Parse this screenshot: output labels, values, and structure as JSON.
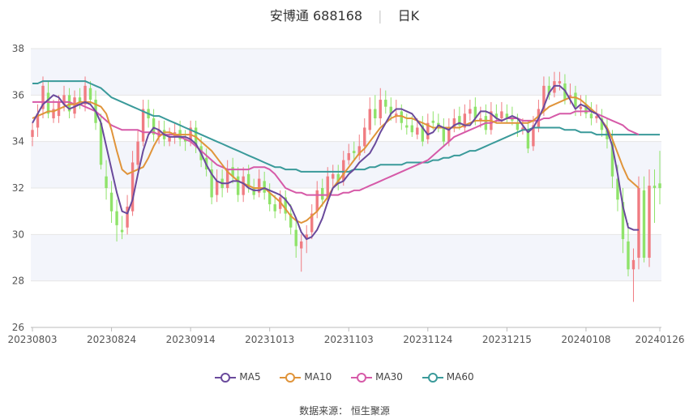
{
  "header": {
    "name": "安博通",
    "code": "688168",
    "period": "日K"
  },
  "source": {
    "label": "数据来源：",
    "name": "恒生聚源"
  },
  "colors": {
    "up": "#f07c82",
    "down": "#8fe36a",
    "ma5": "#6a4a9c",
    "ma10": "#e0943a",
    "ma30": "#d65aa8",
    "ma60": "#3a9a9a",
    "band": "#f3f5fb",
    "grid": "#e6e6e6"
  },
  "chart_data": {
    "type": "candlestick",
    "title": "",
    "y_ticks": [
      26,
      28,
      30,
      32,
      34,
      36,
      38
    ],
    "ylim": [
      26,
      38
    ],
    "x_ticks": [
      "20230803",
      "20230824",
      "20230914",
      "20231013",
      "20231103",
      "20231124",
      "20231215",
      "20240108",
      "20240126"
    ],
    "x_tick_index": [
      0,
      15,
      30,
      45,
      60,
      75,
      90,
      105,
      119
    ],
    "num_bars": 120,
    "legend": [
      "MA5",
      "MA10",
      "MA30",
      "MA60"
    ],
    "ma5": [
      34.8,
      35.2,
      35.6,
      35.8,
      36.0,
      35.9,
      35.6,
      35.4,
      35.5,
      35.6,
      35.7,
      35.6,
      35.3,
      34.8,
      33.8,
      32.8,
      31.8,
      31.0,
      30.9,
      31.5,
      32.6,
      33.6,
      34.3,
      34.6,
      34.5,
      34.3,
      34.2,
      34.2,
      34.2,
      34.2,
      34.1,
      33.9,
      33.5,
      33.0,
      32.6,
      32.3,
      32.2,
      32.2,
      32.3,
      32.3,
      32.2,
      32.0,
      31.9,
      31.9,
      32.0,
      31.9,
      31.8,
      31.7,
      31.5,
      31.2,
      30.7,
      30.1,
      29.8,
      29.9,
      30.2,
      30.7,
      31.4,
      32.0,
      32.2,
      32.3,
      32.6,
      32.8,
      33.1,
      33.3,
      33.5,
      33.9,
      34.4,
      34.8,
      35.2,
      35.4,
      35.4,
      35.3,
      35.2,
      34.9,
      34.6,
      34.3,
      34.4,
      34.7,
      34.6,
      34.5,
      34.7,
      34.8,
      34.7,
      34.7,
      35.0,
      35.3,
      35.3,
      35.2,
      35.0,
      34.9,
      35.0,
      35.1,
      35.0,
      34.7,
      34.4,
      34.6,
      35.0,
      35.5,
      36.1,
      36.4,
      36.4,
      36.2,
      35.8,
      35.4,
      35.6,
      35.5,
      35.3,
      35.2,
      34.9,
      34.5,
      33.8,
      32.6,
      31.2,
      30.3,
      30.2,
      30.2
    ],
    "ma10": [
      35.0,
      35.1,
      35.2,
      35.3,
      35.3,
      35.4,
      35.5,
      35.6,
      35.6,
      35.7,
      35.7,
      35.7,
      35.6,
      35.5,
      35.2,
      34.5,
      33.6,
      32.8,
      32.6,
      32.7,
      32.8,
      32.9,
      33.3,
      33.8,
      34.2,
      34.4,
      34.4,
      34.3,
      34.3,
      34.3,
      34.3,
      34.2,
      34.0,
      33.8,
      33.6,
      33.3,
      33.0,
      32.7,
      32.5,
      32.3,
      32.2,
      32.1,
      32.0,
      32.0,
      32.0,
      31.8,
      31.6,
      31.4,
      31.1,
      30.8,
      30.6,
      30.5,
      30.6,
      30.8,
      31.0,
      31.3,
      31.6,
      32.0,
      32.3,
      32.6,
      32.9,
      33.2,
      33.5,
      33.7,
      34.0,
      34.3,
      34.6,
      34.8,
      35.0,
      35.1,
      35.1,
      35.0,
      35.0,
      34.9,
      34.8,
      34.7,
      34.6,
      34.6,
      34.6,
      34.6,
      34.6,
      34.6,
      34.7,
      34.8,
      34.9,
      34.9,
      34.9,
      34.9,
      34.8,
      34.8,
      34.8,
      34.8,
      34.8,
      34.8,
      34.8,
      34.9,
      35.1,
      35.3,
      35.5,
      35.6,
      35.7,
      35.8,
      35.9,
      35.9,
      35.8,
      35.6,
      35.4,
      35.2,
      34.9,
      34.6,
      34.1,
      33.5,
      32.9,
      32.4,
      32.2,
      32.0
    ],
    "ma30": [
      35.7,
      35.7,
      35.7,
      35.7,
      35.7,
      35.7,
      35.7,
      35.7,
      35.6,
      35.6,
      35.5,
      35.4,
      35.3,
      35.1,
      34.9,
      34.7,
      34.6,
      34.5,
      34.5,
      34.5,
      34.5,
      34.4,
      34.4,
      34.4,
      34.3,
      34.3,
      34.3,
      34.3,
      34.2,
      34.1,
      34.0,
      33.8,
      33.6,
      33.4,
      33.2,
      33.0,
      32.9,
      32.8,
      32.8,
      32.8,
      32.8,
      32.8,
      32.9,
      32.9,
      32.9,
      32.8,
      32.6,
      32.3,
      32.0,
      31.9,
      31.8,
      31.8,
      31.7,
      31.7,
      31.7,
      31.7,
      31.7,
      31.7,
      31.7,
      31.8,
      31.8,
      31.9,
      31.9,
      32.0,
      32.1,
      32.2,
      32.3,
      32.4,
      32.5,
      32.6,
      32.7,
      32.8,
      32.9,
      33.0,
      33.1,
      33.2,
      33.4,
      33.6,
      33.8,
      34.0,
      34.2,
      34.3,
      34.4,
      34.5,
      34.6,
      34.7,
      34.8,
      34.8,
      34.9,
      34.9,
      35.0,
      35.0,
      35.0,
      34.9,
      34.9,
      34.9,
      34.9,
      35.0,
      35.0,
      35.1,
      35.2,
      35.2,
      35.2,
      35.3,
      35.3,
      35.3,
      35.3,
      35.2,
      35.1,
      35.0,
      34.9,
      34.8,
      34.7,
      34.5,
      34.4,
      34.3
    ],
    "ma60": [
      36.5,
      36.5,
      36.6,
      36.6,
      36.6,
      36.6,
      36.6,
      36.6,
      36.6,
      36.6,
      36.6,
      36.5,
      36.4,
      36.3,
      36.1,
      35.9,
      35.8,
      35.7,
      35.6,
      35.5,
      35.4,
      35.3,
      35.2,
      35.1,
      35.1,
      35.0,
      34.9,
      34.8,
      34.7,
      34.6,
      34.5,
      34.4,
      34.3,
      34.2,
      34.1,
      34.0,
      33.9,
      33.8,
      33.7,
      33.6,
      33.5,
      33.4,
      33.3,
      33.2,
      33.1,
      33.0,
      32.9,
      32.9,
      32.8,
      32.8,
      32.8,
      32.7,
      32.7,
      32.7,
      32.7,
      32.7,
      32.7,
      32.7,
      32.7,
      32.7,
      32.7,
      32.8,
      32.8,
      32.8,
      32.9,
      32.9,
      33.0,
      33.0,
      33.0,
      33.0,
      33.0,
      33.1,
      33.1,
      33.1,
      33.1,
      33.1,
      33.2,
      33.2,
      33.3,
      33.3,
      33.4,
      33.4,
      33.5,
      33.6,
      33.6,
      33.7,
      33.8,
      33.9,
      34.0,
      34.1,
      34.2,
      34.3,
      34.4,
      34.5,
      34.5,
      34.6,
      34.6,
      34.6,
      34.6,
      34.6,
      34.6,
      34.5,
      34.5,
      34.5,
      34.4,
      34.4,
      34.4,
      34.3,
      34.3,
      34.3,
      34.3,
      34.3,
      34.3,
      34.3,
      34.3,
      34.3,
      34.3,
      34.3,
      34.3,
      34.3
    ],
    "close": [
      34.5,
      35.2,
      36.4,
      35.2,
      35.4,
      35.7,
      36.0,
      35.3,
      35.9,
      35.7,
      36.4,
      35.8,
      34.8,
      33.0,
      32.0,
      31.0,
      30.4,
      30.1,
      31.2,
      33.1,
      34.0,
      35.4,
      35.0,
      34.3,
      34.5,
      34.1,
      34.2,
      34.4,
      34.1,
      34.0,
      34.6,
      33.8,
      33.2,
      32.8,
      31.6,
      32.3,
      32.0,
      32.8,
      32.5,
      31.7,
      32.5,
      32.0,
      31.7,
      32.4,
      31.8,
      31.3,
      31.0,
      31.6,
      30.9,
      30.3,
      29.5,
      29.7,
      30.0,
      30.9,
      31.9,
      31.5,
      32.5,
      32.6,
      32.2,
      33.2,
      33.5,
      33.5,
      33.8,
      34.6,
      35.4,
      35.0,
      35.8,
      35.5,
      35.2,
      35.2,
      34.8,
      34.6,
      34.4,
      34.6,
      34.0,
      34.8,
      34.8,
      34.6,
      34.0,
      34.6,
      35.0,
      34.7,
      35.2,
      35.4,
      35.0,
      35.0,
      34.5,
      35.3,
      35.0,
      35.3,
      35.0,
      34.9,
      34.5,
      34.6,
      33.7,
      34.7,
      35.4,
      36.4,
      36.0,
      36.6,
      36.6,
      35.8,
      36.0,
      35.5,
      35.5,
      35.2,
      35.0,
      35.1,
      34.5,
      34.1,
      32.5,
      31.5,
      29.8,
      28.5,
      28.9,
      32.0,
      29.0,
      32.1,
      32.0,
      32.0
    ],
    "open": [
      34.2,
      34.6,
      35.4,
      36.1,
      35.0,
      35.1,
      35.6,
      36.0,
      35.2,
      35.9,
      35.6,
      36.3,
      35.8,
      34.8,
      32.5,
      31.8,
      31.0,
      30.2,
      30.3,
      31.0,
      33.0,
      34.0,
      35.4,
      35.0,
      34.2,
      34.5,
      34.0,
      34.2,
      34.5,
      34.1,
      34.0,
      34.6,
      33.8,
      33.3,
      32.8,
      31.7,
      32.4,
      32.0,
      32.9,
      32.5,
      31.7,
      32.6,
      32.0,
      31.8,
      32.3,
      31.8,
      31.3,
      31.1,
      31.6,
      30.9,
      30.2,
      29.4,
      29.8,
      30.1,
      31.0,
      32.0,
      31.6,
      32.4,
      32.6,
      32.3,
      33.2,
      33.6,
      33.4,
      33.8,
      34.5,
      35.4,
      35.0,
      35.8,
      35.5,
      35.1,
      35.3,
      34.7,
      34.7,
      34.3,
      34.7,
      34.1,
      34.9,
      34.8,
      34.6,
      34.0,
      34.6,
      35.1,
      34.6,
      35.2,
      35.5,
      34.9,
      35.1,
      34.5,
      35.2,
      35.0,
      35.2,
      35.0,
      34.8,
      34.5,
      34.5,
      33.8,
      34.6,
      35.3,
      36.4,
      36.1,
      36.5,
      36.5,
      35.9,
      36.1,
      35.4,
      35.6,
      35.2,
      35.0,
      35.0,
      34.5,
      34.0,
      32.4,
      31.4,
      29.7,
      28.5,
      29.0,
      31.9,
      29.0,
      32.1,
      32.2
    ],
    "high": [
      34.8,
      35.6,
      36.8,
      36.6,
      35.8,
      36.0,
      36.4,
      36.3,
      36.2,
      36.3,
      36.8,
      36.6,
      36.2,
      35.2,
      33.2,
      32.3,
      31.5,
      30.8,
      31.7,
      33.6,
      34.5,
      35.8,
      35.8,
      35.4,
      34.9,
      34.9,
      34.6,
      34.8,
      34.9,
      34.5,
      34.9,
      34.9,
      34.2,
      33.7,
      33.2,
      32.8,
      32.8,
      33.2,
      33.3,
      32.9,
      32.9,
      33.0,
      32.4,
      32.8,
      32.7,
      32.2,
      31.7,
      31.9,
      31.9,
      31.3,
      30.6,
      30.0,
      30.4,
      31.3,
      32.3,
      32.4,
      32.9,
      33.0,
      33.0,
      33.6,
      33.9,
      34.0,
      34.3,
      35.0,
      35.9,
      36.0,
      36.3,
      36.2,
      35.9,
      35.8,
      35.6,
      35.2,
      35.1,
      35.0,
      35.1,
      35.2,
      35.3,
      35.2,
      35.0,
      35.0,
      35.4,
      35.5,
      35.6,
      35.8,
      35.9,
      35.5,
      35.6,
      35.7,
      35.6,
      35.7,
      35.6,
      35.5,
      35.2,
      35.0,
      34.9,
      35.1,
      35.8,
      36.8,
      36.8,
      37.0,
      37.0,
      36.9,
      36.5,
      36.4,
      36.0,
      36.0,
      35.7,
      35.6,
      35.4,
      35.0,
      34.5,
      33.0,
      32.0,
      30.5,
      29.4,
      32.5,
      32.5,
      32.8,
      32.8,
      33.6
    ],
    "low": [
      33.8,
      34.2,
      35.0,
      35.0,
      34.8,
      34.8,
      35.3,
      35.0,
      35.0,
      35.4,
      35.3,
      35.6,
      34.5,
      32.8,
      31.5,
      30.5,
      29.7,
      29.8,
      30.0,
      30.8,
      32.8,
      33.8,
      34.6,
      34.0,
      33.9,
      33.8,
      33.8,
      33.9,
      33.8,
      33.6,
      33.8,
      33.5,
      32.9,
      32.5,
      31.3,
      31.4,
      31.6,
      31.8,
      32.2,
      31.4,
      31.4,
      31.8,
      31.5,
      31.6,
      31.5,
      31.0,
      30.7,
      30.9,
      30.6,
      30.0,
      29.0,
      28.4,
      29.2,
      29.8,
      30.7,
      31.2,
      31.3,
      32.0,
      31.9,
      32.1,
      33.0,
      33.2,
      33.2,
      33.5,
      34.3,
      34.7,
      34.7,
      35.2,
      34.9,
      34.8,
      34.5,
      34.3,
      34.2,
      34.1,
      33.8,
      33.9,
      34.5,
      34.4,
      33.8,
      33.8,
      34.4,
      34.5,
      34.4,
      34.9,
      34.7,
      34.6,
      34.3,
      34.3,
      34.8,
      34.8,
      34.8,
      34.7,
      34.2,
      34.3,
      33.5,
      33.6,
      34.4,
      35.1,
      35.8,
      35.9,
      36.2,
      35.6,
      35.6,
      35.1,
      35.1,
      35.0,
      34.7,
      34.8,
      34.2,
      33.7,
      32.0,
      31.0,
      29.2,
      28.2,
      27.1,
      28.5,
      28.8,
      28.6,
      30.5,
      31.3
    ]
  }
}
